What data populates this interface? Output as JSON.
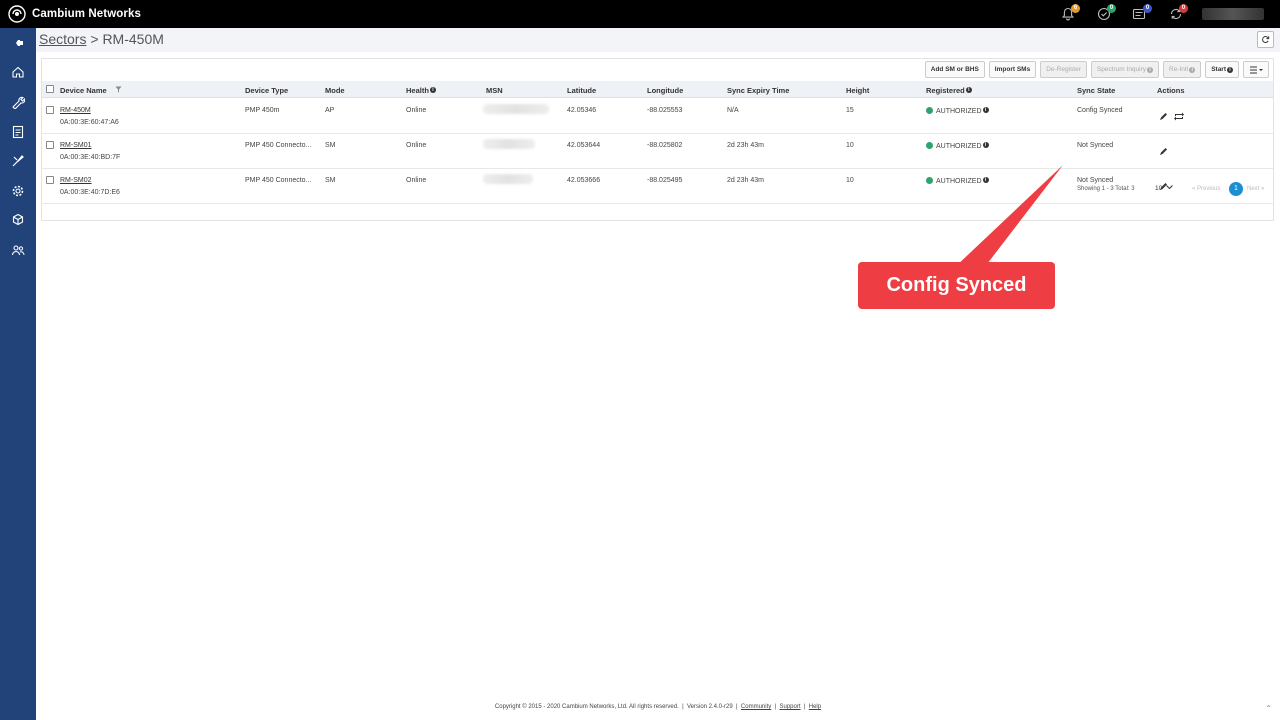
{
  "topbar": {
    "brand": "Cambium Networks",
    "icons": [
      {
        "name": "bell-icon",
        "badge": "6",
        "badge_color": "#e39a2a"
      },
      {
        "name": "check-circle-icon",
        "badge": "0",
        "badge_color": "#2ea36b"
      },
      {
        "name": "tasks-icon",
        "badge": "0",
        "badge_color": "#3f56c8"
      },
      {
        "name": "sync-alert-icon",
        "badge": "0",
        "badge_color": "#d63a3a"
      }
    ]
  },
  "breadcrumb": {
    "link": "Sectors",
    "separator": " > ",
    "current": "RM-450M"
  },
  "toolbar": {
    "add": "Add SM or BHS",
    "import": "Import SMs",
    "deregister": "De-Register",
    "spectrum": "Spectrum Inquiry",
    "reinit": "Re-Init",
    "start": "Start"
  },
  "columns": {
    "device_name": "Device Name",
    "device_type": "Device Type",
    "mode": "Mode",
    "health": "Health",
    "msn": "MSN",
    "latitude": "Latitude",
    "longitude": "Longitude",
    "sync_expiry": "Sync Expiry Time",
    "height": "Height",
    "registered": "Registered",
    "sync_state": "Sync State",
    "actions": "Actions"
  },
  "rows": [
    {
      "name": "RM-450M",
      "mac": "0A:00:3E:60:47:A6",
      "type": "PMP 450m",
      "mode": "AP",
      "health": "Online",
      "latitude": "42.05346",
      "longitude": "-88.025553",
      "sync_expiry": "N/A",
      "height": "15",
      "registered": "AUTHORIZED",
      "sync_state": "Config Synced"
    },
    {
      "name": "RM-SM01",
      "mac": "0A:00:3E:40:BD:7F",
      "type": "PMP 450 Connecto...",
      "mode": "SM",
      "health": "Online",
      "latitude": "42.053644",
      "longitude": "-88.025802",
      "sync_expiry": "2d 23h 43m",
      "height": "10",
      "registered": "AUTHORIZED",
      "sync_state": "Not Synced"
    },
    {
      "name": "RM-SM02",
      "mac": "0A:00:3E:40:7D:E6",
      "type": "PMP 450 Connecto...",
      "mode": "SM",
      "health": "Online",
      "latitude": "42.053666",
      "longitude": "-88.025495",
      "sync_expiry": "2d 23h 43m",
      "height": "10",
      "registered": "AUTHORIZED",
      "sync_state": "Not Synced"
    }
  ],
  "pagination": {
    "showing": "Showing 1 - 3 Total: 3",
    "page_size": "10",
    "prev": "« Previous",
    "page": "1",
    "next": "Next »"
  },
  "callout": "Config Synced",
  "footer": {
    "copyright": "Copyright © 2015 - 2020 Cambium Networks, Ltd. All rights reserved.",
    "version": "Version 2.4.0-r29",
    "community": "Community",
    "support": "Support",
    "help": "Help"
  }
}
